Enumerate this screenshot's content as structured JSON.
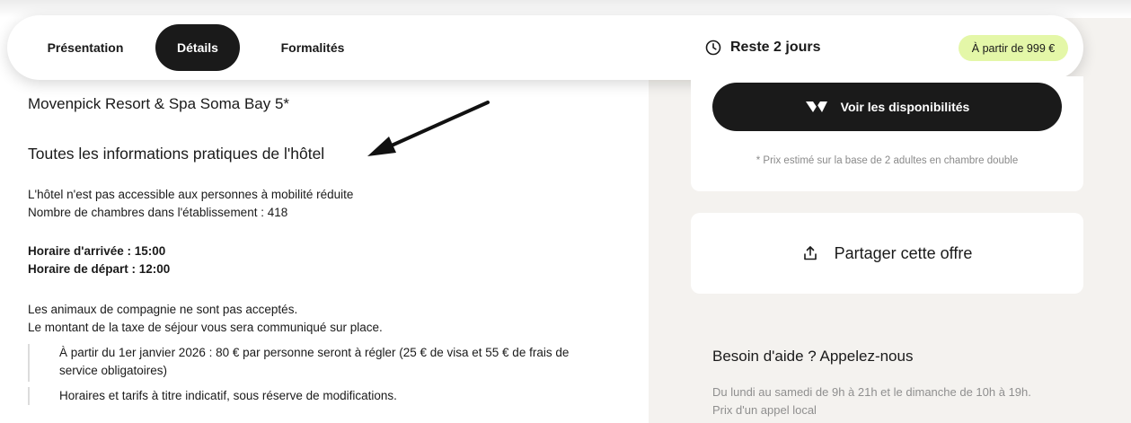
{
  "nav": {
    "tabs": [
      {
        "label": "Présentation"
      },
      {
        "label": "Détails"
      },
      {
        "label": "Formalités"
      }
    ],
    "countdown": "Reste 2 jours",
    "price_pill": "À partir de 999 €"
  },
  "content": {
    "hotel_name": "Movenpick Resort & Spa Soma Bay 5*",
    "section_title": "Toutes les informations pratiques de l'hôtel",
    "accessibility": "L'hôtel n'est pas accessible aux personnes à mobilité réduite",
    "rooms": "Nombre de chambres dans l'établissement : 418",
    "checkin": "Horaire d'arrivée : 15:00",
    "checkout": "Horaire de départ : 12:00",
    "pets": "Les animaux de compagnie ne sont pas acceptés.",
    "tax": "Le montant de la taxe de séjour vous sera communiqué sur place.",
    "notes": [
      {
        "line1": "À partir du 1er janvier 2026 : 80 € par personne seront à régler (25 € de visa et 55 € de frais de",
        "line2": "service obligatoires)"
      },
      {
        "line1": "Horaires et tarifs à titre indicatif, sous réserve de modifications."
      }
    ]
  },
  "sidebar": {
    "cta_label": "Voir les disponibilités",
    "price_note": "* Prix estimé sur la base de 2 adultes en chambre double",
    "share_label": "Partager cette offre",
    "help_title": "Besoin d'aide ? Appelez-nous",
    "help_hours": "Du lundi au samedi de 9h à 21h et le dimanche de 10h à 19h.",
    "help_cost": "Prix d'un appel local"
  },
  "icons": {
    "clock": "clock-icon",
    "brand": "brand-logo-icon",
    "share": "share-icon",
    "arrow": "annotation-arrow"
  },
  "colors": {
    "active_tab": "#1a1a1a",
    "price_pill_bg": "#e4f7a8",
    "sidebar_bg": "#f4f2ef"
  }
}
